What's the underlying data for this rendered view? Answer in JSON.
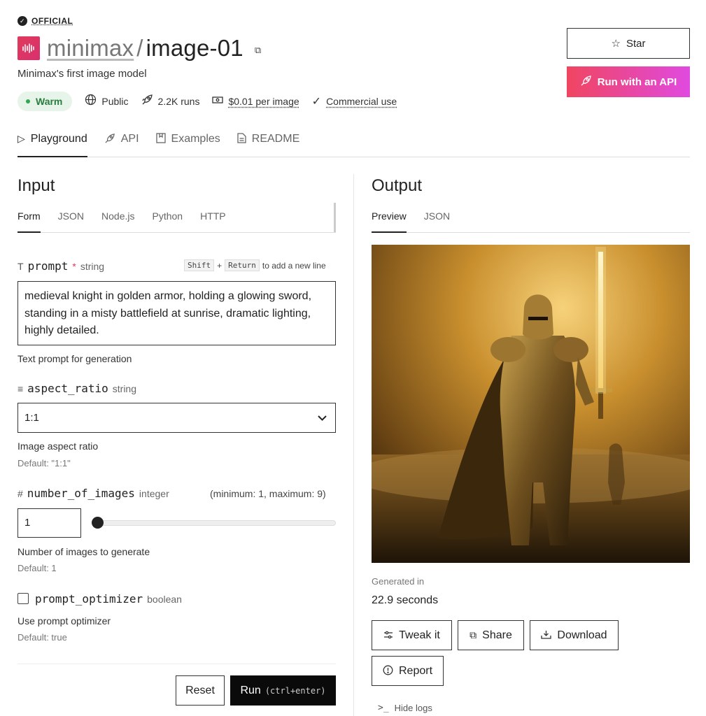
{
  "header": {
    "official_label": "OFFICIAL",
    "logo_text": "MINIMAX",
    "owner": "minimax",
    "separator": "/",
    "model": "image-01",
    "subtitle": "Minimax's first image model",
    "status": "Warm",
    "visibility": "Public",
    "runs": "2.2K runs",
    "price": "$0.01 per image",
    "license": "Commercial use",
    "star_label": "Star",
    "api_label": "Run with an API"
  },
  "main_tabs": [
    "Playground",
    "API",
    "Examples",
    "README"
  ],
  "input": {
    "title": "Input",
    "tabs": [
      "Form",
      "JSON",
      "Node.js",
      "Python",
      "HTTP"
    ],
    "prompt": {
      "name": "prompt",
      "required_mark": "*",
      "type": "string",
      "hint_key1": "Shift",
      "hint_plus": "+",
      "hint_key2": "Return",
      "hint_text": "to add a new line",
      "value": "medieval knight in golden armor, holding a glowing sword, standing in a misty battlefield at sunrise, dramatic lighting, highly detailed.",
      "description": "Text prompt for generation"
    },
    "aspect_ratio": {
      "name": "aspect_ratio",
      "type": "string",
      "value": "1:1",
      "description": "Image aspect ratio",
      "default": "Default: \"1:1\""
    },
    "number_of_images": {
      "name": "number_of_images",
      "type": "integer",
      "range": "(minimum: 1, maximum: 9)",
      "value": "1",
      "slider_fraction": 0,
      "description": "Number of images to generate",
      "default": "Default: 1"
    },
    "prompt_optimizer": {
      "name": "prompt_optimizer",
      "type": "boolean",
      "checked": false,
      "description": "Use prompt optimizer",
      "default": "Default: true"
    },
    "reset_label": "Reset",
    "run_label": "Run",
    "run_shortcut": "(ctrl+enter)"
  },
  "output": {
    "title": "Output",
    "tabs": [
      "Preview",
      "JSON"
    ],
    "generated_label": "Generated in",
    "generated_value": "22.9 seconds",
    "tweak_label": "Tweak it",
    "share_label": "Share",
    "download_label": "Download",
    "report_label": "Report",
    "logs_label": "Hide logs"
  },
  "colors": {
    "accent_gradient_start": "#f04560",
    "accent_gradient_end": "#e04ae0",
    "warm_bg": "#e6f4ea",
    "warm_text": "#2a7d3e"
  }
}
